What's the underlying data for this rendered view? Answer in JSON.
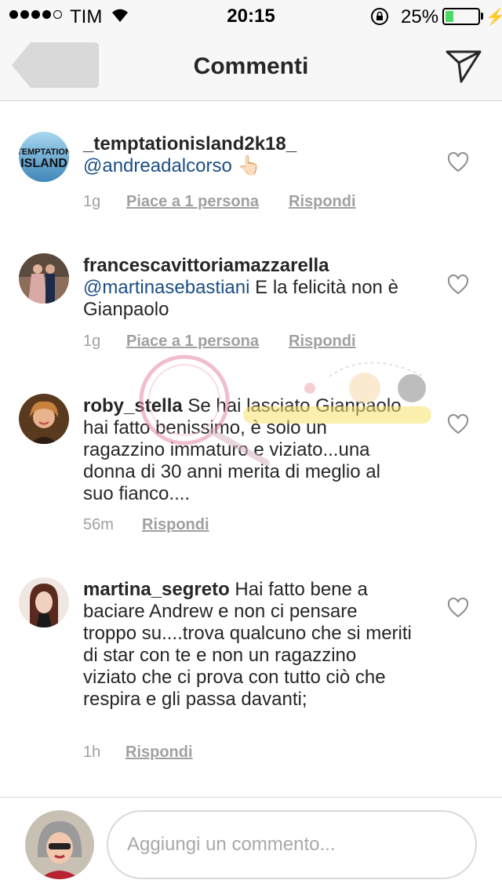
{
  "status_bar": {
    "carrier": "TIM",
    "time": "20:15",
    "battery_percent": "25%",
    "battery_level": 0.25,
    "icons": [
      "signal-dots-icon",
      "wifi-icon",
      "rotation-lock-icon",
      "battery-icon",
      "charging-bolt-icon"
    ]
  },
  "nav": {
    "title": "Commenti",
    "icons": [
      "back-icon",
      "send-direct-icon"
    ]
  },
  "comments": [
    {
      "username": "_temptationisland2k18_",
      "mention": "@andreadalcorso",
      "text": " 👆🏻",
      "time": "1g",
      "likes": "Piace a 1 persona",
      "reply": "Rispondi"
    },
    {
      "username": "francescavittoriamazzarella",
      "mention": "@martinasebastiani",
      "text": "  E la felicità non è Gianpaolo",
      "time": "1g",
      "likes": "Piace a 1 persona",
      "reply": "Rispondi"
    },
    {
      "username": "roby_stella",
      "mention": "",
      "text": " Se hai lasciato Gianpaolo hai fatto benissimo, è solo un ragazzino immaturo e viziato...una donna di 30 anni merita di meglio al suo fianco....",
      "time": "56m",
      "likes": "",
      "reply": "Rispondi"
    },
    {
      "username": "martina_segreto",
      "mention": "",
      "text": " Hai fatto bene a baciare Andrew e non ci pensare troppo su....trova qualcuno che si meriti di star con te e non un ragazzino viziato che ci prova con tutto ciò che respira e gli passa davanti;",
      "time": "1h",
      "likes": "",
      "reply": "Rispondi"
    }
  ],
  "avatar_logo_text": "TEMPTATION ISLAND",
  "composer": {
    "placeholder": "Aggiungi un commento..."
  },
  "colors": {
    "mention": "#1b4f84",
    "battery": "#4cd964",
    "meta": "#a0a0a0"
  }
}
